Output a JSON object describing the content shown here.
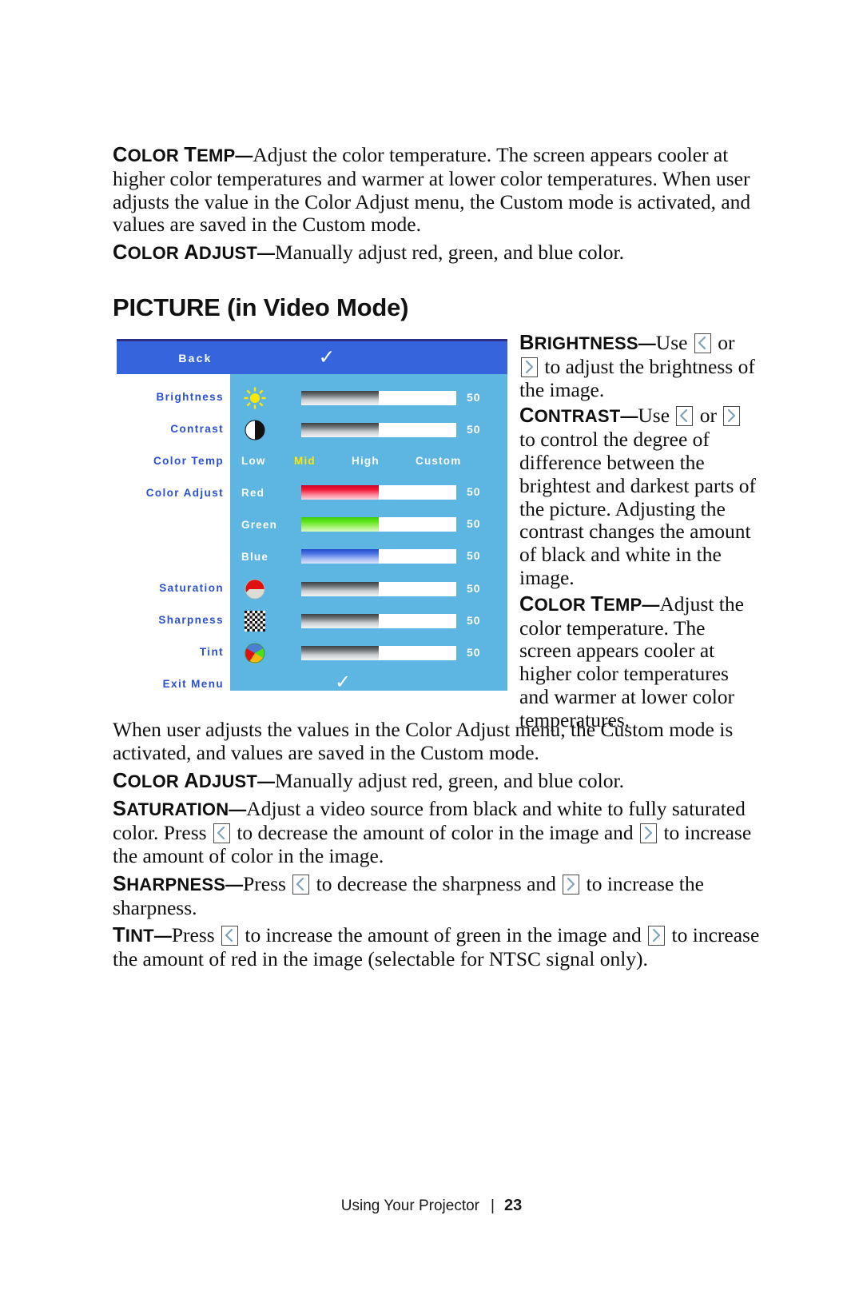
{
  "document": {
    "section_heading": "PICTURE (in Video Mode)",
    "footer": {
      "chapter": "Using Your Projector",
      "separator": "|",
      "page_number": "23"
    }
  },
  "intro": {
    "color_temp": {
      "term_first": "C",
      "term_rest": "OLOR ",
      "term_second_first": "T",
      "term_second_rest": "EMP",
      "dash": "—",
      "text": "Adjust the color temperature. The screen appears cooler at higher color temperatures and warmer at lower color temperatures. When user adjusts the value in the Color Adjust menu, the Custom mode is activated, and values are saved in the Custom mode."
    },
    "color_adjust": {
      "term_first": "C",
      "term_rest": "OLOR ",
      "term_second_first": "A",
      "term_second_rest": "DJUST",
      "dash": "—",
      "text": "Manually adjust red, green, and blue color."
    }
  },
  "sidecol": {
    "brightness": {
      "term_first": "B",
      "term_rest": "RIGHTNESS",
      "dash": "—",
      "pre": "Use ",
      "mid": " or ",
      "post": " to adjust the brightness of the image."
    },
    "contrast": {
      "term_first": "C",
      "term_rest": "ONTRAST",
      "dash": "—",
      "pre": "Use ",
      "mid": " or ",
      "post": " to control the degree of difference between the brightest and darkest parts of the picture. Adjusting the contrast changes the amount of black and white in the image."
    },
    "color_temp": {
      "term_first": "C",
      "term_rest": "OLOR ",
      "term_second_first": "T",
      "term_second_rest": "EMP",
      "dash": "—",
      "text": "Adjust the color temperature. The screen appears cooler at higher color temperatures and warmer at lower color temperatures."
    }
  },
  "lower": {
    "custom_mode": "When user adjusts the values in the Color Adjust menu, the Custom mode is activated, and values are saved in the Custom mode.",
    "color_adjust": {
      "term_first": "C",
      "term_rest": "OLOR ",
      "term_second_first": "A",
      "term_second_rest": "DJUST",
      "dash": "—",
      "text": "Manually adjust red, green, and blue color."
    },
    "saturation": {
      "term_first": "S",
      "term_rest": "ATURATION",
      "dash": "—",
      "pre": "Adjust a video source from black and white to fully saturated color. Press ",
      "mid": " to decrease the amount of color in the image and ",
      "post": " to increase the amount of color in the image."
    },
    "sharpness": {
      "term_first": "S",
      "term_rest": "HARPNESS",
      "dash": "—",
      "pre": "Press ",
      "mid": " to decrease the sharpness and ",
      "post": " to increase the sharpness."
    },
    "tint": {
      "term_first": "T",
      "term_rest": "INT",
      "dash": "—",
      "pre": "Press ",
      "mid": " to increase the amount of green in the image and ",
      "post": " to increase the amount of red in the image (selectable for NTSC signal only)."
    }
  },
  "osd": {
    "title": "Back",
    "header_confirm_icon": "✓",
    "colors": {
      "header_bg": "#3664dd",
      "body_bg": "#5db5e2",
      "left_bg": "#ffffff",
      "label": "#2b4fd2",
      "border": "#2b2f86",
      "selected_option": "#ffe800"
    },
    "rows": [
      {
        "label": "Brightness",
        "icon": "sun-icon",
        "value": "50",
        "fill_pct": 50,
        "fill_style": "gray"
      },
      {
        "label": "Contrast",
        "icon": "contrast-circle-icon",
        "value": "50",
        "fill_pct": 50,
        "fill_style": "gray"
      },
      {
        "label": "Saturation",
        "icon": "saturation-circle-icon",
        "value": "50",
        "fill_pct": 50,
        "fill_style": "gray"
      },
      {
        "label": "Sharpness",
        "icon": "checkerboard-icon",
        "value": "50",
        "fill_pct": 50,
        "fill_style": "gray"
      },
      {
        "label": "Tint",
        "icon": "color-wheel-icon",
        "value": "50",
        "fill_pct": 50,
        "fill_style": "gray"
      }
    ],
    "color_temp": {
      "label": "Color Temp",
      "options": [
        "Low",
        "Mid",
        "High",
        "Custom"
      ],
      "selected": "Mid"
    },
    "color_adjust": {
      "label": "Color Adjust",
      "channels": [
        {
          "name": "Red",
          "value": "50",
          "fill_pct": 50,
          "fill_style": "red"
        },
        {
          "name": "Green",
          "value": "50",
          "fill_pct": 50,
          "fill_style": "green"
        },
        {
          "name": "Blue",
          "value": "50",
          "fill_pct": 50,
          "fill_style": "blue"
        }
      ]
    },
    "exit": {
      "label": "Exit Menu",
      "icon": "✓"
    }
  }
}
